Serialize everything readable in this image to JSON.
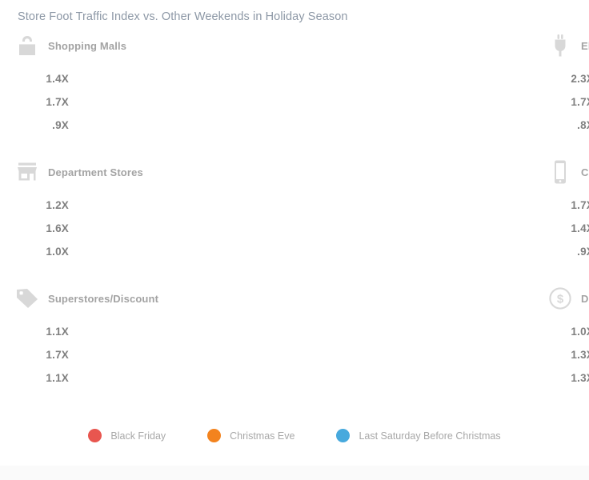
{
  "title": "Store Foot Traffic Index vs. Other Weekends in Holiday Season",
  "colors": {
    "black_friday": "#e8564f",
    "christmas_eve": "#f3831e",
    "last_saturday": "#47a9dd",
    "icon_gray": "#d8d8d8",
    "label_gray": "#a3a3a3",
    "value_gray": "#808080",
    "title_gray": "#8d98a6",
    "background": "#ffffff"
  },
  "legend": {
    "items": [
      {
        "label": "Black Friday",
        "color": "#e8564f",
        "icon": "circle-icon"
      },
      {
        "label": "Christmas Eve",
        "color": "#f3831e",
        "icon": "circle-icon"
      },
      {
        "label": "Last Saturday Before Christmas",
        "color": "#47a9dd",
        "icon": "circle-icon"
      }
    ]
  },
  "chart_data": {
    "type": "bar",
    "title": "Store Foot Traffic Index vs. Other Weekends in Holiday Season",
    "xlabel": "",
    "ylabel": "",
    "orientation": "horizontal",
    "grid": false,
    "legend_position": "bottom",
    "unit": "X",
    "axis_max": 2.3,
    "categories": [
      "Shopping Malls",
      "Electronics Stores",
      "Department Stores",
      "Cellphone Stores",
      "Superstores/Discount",
      "Dollar Stores"
    ],
    "series": [
      {
        "name": "Black Friday",
        "color": "#e8564f",
        "values": [
          1.4,
          2.3,
          1.2,
          1.7,
          1.1,
          1.0
        ]
      },
      {
        "name": "Last Saturday Before Christmas",
        "color": "#47a9dd",
        "values": [
          1.7,
          1.7,
          1.6,
          1.4,
          1.7,
          1.3
        ]
      },
      {
        "name": "Christmas Eve",
        "color": "#f3831e",
        "values": [
          0.9,
          0.8,
          1.0,
          0.9,
          1.1,
          1.3
        ]
      }
    ]
  },
  "panels": [
    {
      "label": "Shopping Malls",
      "icon": "shopping-bag-icon",
      "bars": [
        {
          "value_label": "1.4X",
          "value": 1.4,
          "series": "Black Friday",
          "color": "#e8564f"
        },
        {
          "value_label": "1.7X",
          "value": 1.7,
          "series": "Last Saturday Before Christmas",
          "color": "#47a9dd"
        },
        {
          "value_label": ".9X",
          "value": 0.9,
          "series": "Christmas Eve",
          "color": "#f3831e"
        }
      ]
    },
    {
      "label": "Electronics Stores",
      "icon": "power-plug-icon",
      "bars": [
        {
          "value_label": "2.3X",
          "value": 2.3,
          "series": "Black Friday",
          "color": "#e8564f"
        },
        {
          "value_label": "1.7X",
          "value": 1.7,
          "series": "Last Saturday Before Christmas",
          "color": "#47a9dd"
        },
        {
          "value_label": ".8X",
          "value": 0.8,
          "series": "Christmas Eve",
          "color": "#f3831e"
        }
      ]
    },
    {
      "label": "Department Stores",
      "icon": "storefront-icon",
      "bars": [
        {
          "value_label": "1.2X",
          "value": 1.2,
          "series": "Black Friday",
          "color": "#e8564f"
        },
        {
          "value_label": "1.6X",
          "value": 1.6,
          "series": "Last Saturday Before Christmas",
          "color": "#47a9dd"
        },
        {
          "value_label": "1.0X",
          "value": 1.0,
          "series": "Christmas Eve",
          "color": "#f3831e"
        }
      ]
    },
    {
      "label": "Cellphone Stores",
      "icon": "smartphone-icon",
      "bars": [
        {
          "value_label": "1.7X",
          "value": 1.7,
          "series": "Black Friday",
          "color": "#e8564f"
        },
        {
          "value_label": "1.4X",
          "value": 1.4,
          "series": "Last Saturday Before Christmas",
          "color": "#47a9dd"
        },
        {
          "value_label": ".9X",
          "value": 0.9,
          "series": "Christmas Eve",
          "color": "#f3831e"
        }
      ]
    },
    {
      "label": "Superstores/Discount",
      "icon": "price-tag-icon",
      "bars": [
        {
          "value_label": "1.1X",
          "value": 1.1,
          "series": "Black Friday",
          "color": "#e8564f"
        },
        {
          "value_label": "1.7X",
          "value": 1.7,
          "series": "Last Saturday Before Christmas",
          "color": "#47a9dd"
        },
        {
          "value_label": "1.1X",
          "value": 1.1,
          "series": "Christmas Eve",
          "color": "#f3831e"
        }
      ]
    },
    {
      "label": "Dollar Stores",
      "icon": "dollar-circle-icon",
      "bars": [
        {
          "value_label": "1.0X",
          "value": 1.0,
          "series": "Black Friday",
          "color": "#e8564f"
        },
        {
          "value_label": "1.3X",
          "value": 1.3,
          "series": "Last Saturday Before Christmas",
          "color": "#47a9dd"
        },
        {
          "value_label": "1.3X",
          "value": 1.3,
          "series": "Christmas Eve",
          "color": "#f3831e"
        }
      ]
    }
  ]
}
